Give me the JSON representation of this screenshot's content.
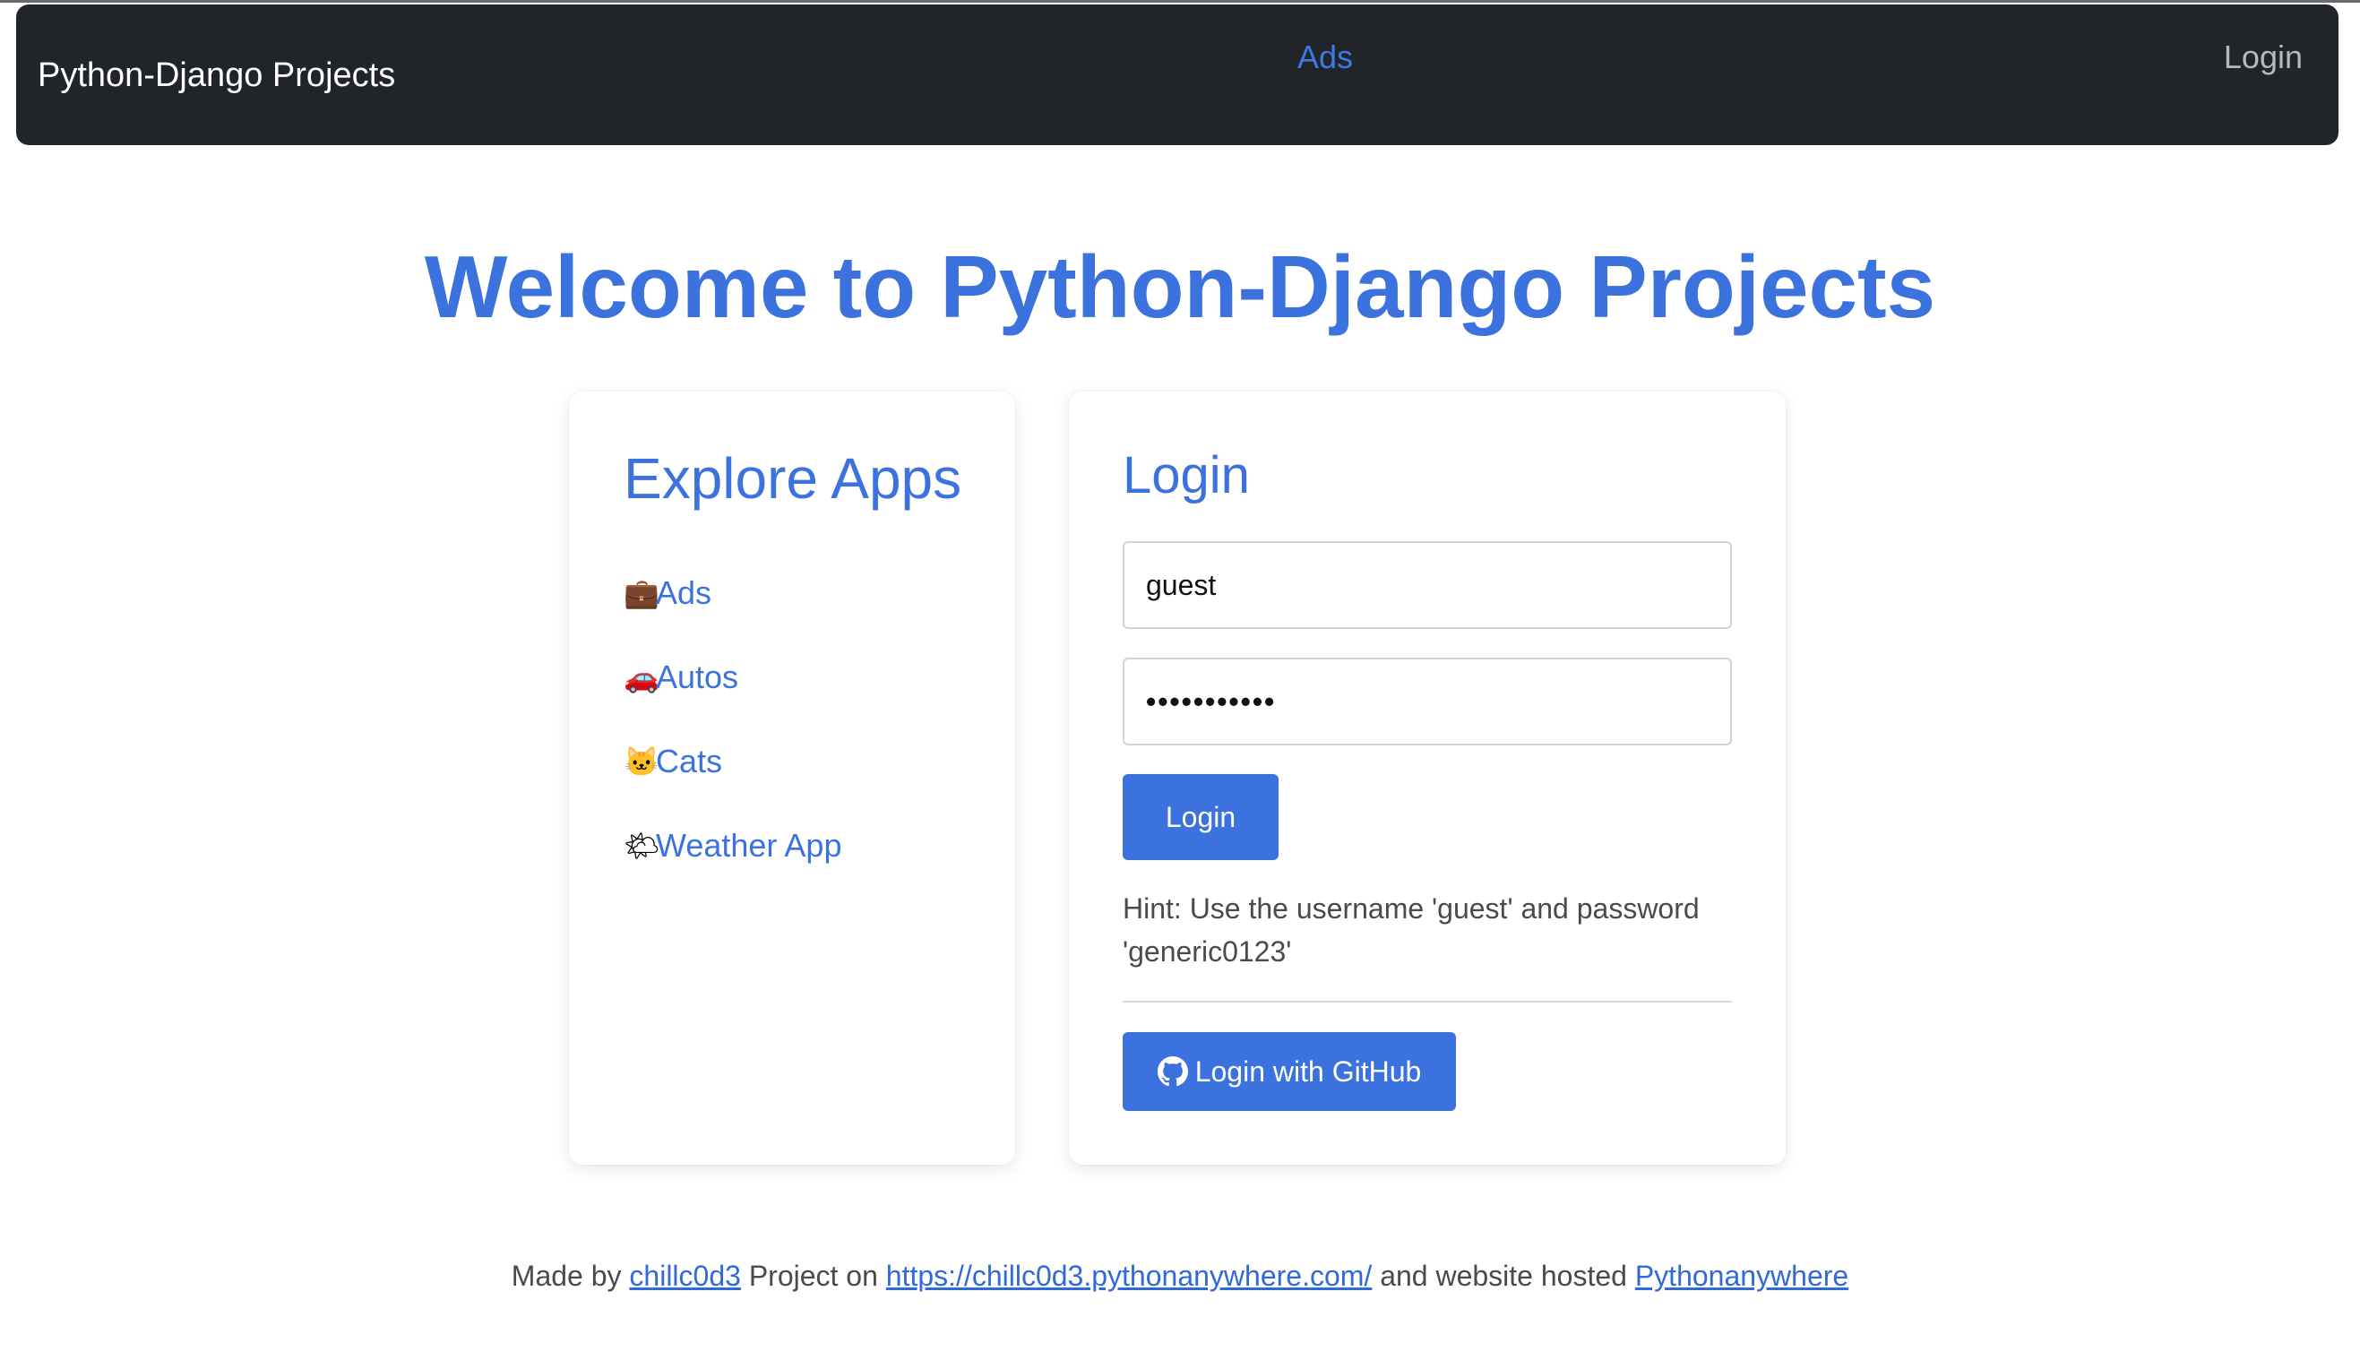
{
  "navbar": {
    "brand": "Python-Django Projects",
    "ads_link": "Ads",
    "login_link": "Login"
  },
  "hero": {
    "title": "Welcome to Python-Django Projects"
  },
  "apps_card": {
    "title": "Explore Apps",
    "items": [
      {
        "icon": "💼",
        "icon_name": "briefcase-icon",
        "label": "Ads"
      },
      {
        "icon": "🚗",
        "icon_name": "car-icon",
        "label": "Autos"
      },
      {
        "icon": "🐱",
        "icon_name": "cat-icon",
        "label": "Cats"
      },
      {
        "icon": "🌤",
        "icon_name": "sun-cloud-icon",
        "label": "Weather App"
      }
    ]
  },
  "login_card": {
    "title": "Login",
    "username_value": "guest",
    "password_mask": "•••••••••••",
    "login_button": "Login",
    "hint": "Hint: Use the username 'guest' and password 'generic0123'",
    "github_button": "Login with GitHub"
  },
  "footer": {
    "made_by": "Made by",
    "author": "chillc0d3",
    "project_on": "Project on",
    "project_url": "https://chillc0d3.pythonanywhere.com/",
    "hosted_text": "and website hosted",
    "host": "Pythonanywhere"
  },
  "colors": {
    "accent": "#3b72dd",
    "navbar_bg": "#212529",
    "text_muted": "#4a4a4a"
  }
}
